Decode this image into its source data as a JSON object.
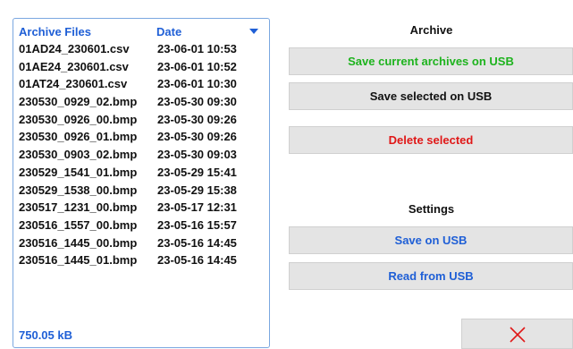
{
  "file_list": {
    "header_files": "Archive Files",
    "header_date": "Date",
    "files": [
      {
        "name": "01AD24_230601.csv",
        "date": "23-06-01 10:53"
      },
      {
        "name": "01AE24_230601.csv",
        "date": "23-06-01 10:52"
      },
      {
        "name": "01AT24_230601.csv",
        "date": "23-06-01 10:30"
      },
      {
        "name": "230530_0929_02.bmp",
        "date": "23-05-30 09:30"
      },
      {
        "name": "230530_0926_00.bmp",
        "date": "23-05-30 09:26"
      },
      {
        "name": "230530_0926_01.bmp",
        "date": "23-05-30 09:26"
      },
      {
        "name": "230530_0903_02.bmp",
        "date": "23-05-30 09:03"
      },
      {
        "name": "230529_1541_01.bmp",
        "date": "23-05-29 15:41"
      },
      {
        "name": "230529_1538_00.bmp",
        "date": "23-05-29 15:38"
      },
      {
        "name": "230517_1231_00.bmp",
        "date": "23-05-17 12:31"
      },
      {
        "name": "230516_1557_00.bmp",
        "date": "23-05-16 15:57"
      },
      {
        "name": "230516_1445_00.bmp",
        "date": "23-05-16 14:45"
      },
      {
        "name": "230516_1445_01.bmp",
        "date": "23-05-16 14:45"
      }
    ],
    "total_size": "750.05 kB"
  },
  "archive": {
    "title": "Archive",
    "save_current_label": "Save current archives on USB",
    "save_selected_label": "Save selected on USB",
    "delete_selected_label": "Delete selected"
  },
  "settings": {
    "title": "Settings",
    "save_label": "Save on USB",
    "read_label": "Read from USB"
  },
  "icons": {
    "close": "close-icon",
    "sort": "sort-descending-icon"
  },
  "colors": {
    "accent_blue": "#1f5fd6",
    "save_green": "#1db31d",
    "delete_red": "#e01818",
    "button_bg": "#e4e4e4"
  }
}
